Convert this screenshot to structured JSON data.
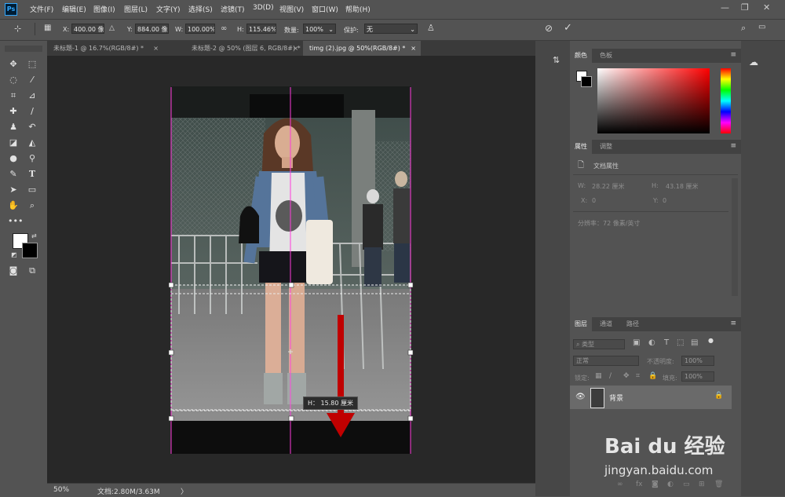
{
  "app": {
    "logo": "Ps"
  },
  "menu": [
    "文件(F)",
    "编辑(E)",
    "图像(I)",
    "图层(L)",
    "文字(Y)",
    "选择(S)",
    "滤镜(T)",
    "3D(D)",
    "视图(V)",
    "窗口(W)",
    "帮助(H)"
  ],
  "window_controls": {
    "minimize": "—",
    "restore": "❐",
    "close": "✕"
  },
  "options": {
    "x_label": "X:",
    "x_value": "400.00 像素",
    "y_label": "Y:",
    "y_value": "884.00 像素",
    "w_label": "W:",
    "w_value": "100.00%",
    "h_label": "H:",
    "h_value": "115.46%",
    "amount_label": "数量:",
    "amount_value": "100%",
    "protect_label": "保护:",
    "protect_value": "无"
  },
  "tabs": [
    {
      "label": "未标题-1 @ 16.7%(RGB/8#) *",
      "close": "×"
    },
    {
      "label": "未标题-2 @ 50% (图层 6, RGB/8#) *",
      "close": "×"
    },
    {
      "label": "timg (2).jpg @ 50%(RGB/8#) *",
      "close": "×"
    }
  ],
  "canvas": {
    "tooltip": "H： 15.80 厘米",
    "arrow_color": "#c00000"
  },
  "status": {
    "zoom": "50%",
    "doc_info": "文档:2.80M/3.63M",
    "arrow": "〉"
  },
  "color_panel": {
    "tabs": [
      "颜色",
      "色板"
    ]
  },
  "properties_panel": {
    "tabs": [
      "属性",
      "调整"
    ],
    "header": "文档属性",
    "w_label": "W:",
    "w_value": "28.22 厘米",
    "h_label": "H:",
    "h_value": "43.18 厘米",
    "x_label": "X:",
    "x_value": "0",
    "y_label": "Y:",
    "y_value": "0",
    "resolution": "分辨率：72 像素/英寸"
  },
  "layers_panel": {
    "tabs": [
      "图层",
      "通道",
      "路径"
    ],
    "filter_label": "类型",
    "blend_mode": "正常",
    "opacity_label": "不透明度:",
    "opacity_value": "100%",
    "lock_label": "锁定:",
    "fill_label": "填充:",
    "fill_value": "100%",
    "layers": [
      {
        "name": "背景"
      }
    ]
  },
  "watermark": {
    "brand": "Bai du 经验",
    "url": "jingyan.baidu.com"
  }
}
